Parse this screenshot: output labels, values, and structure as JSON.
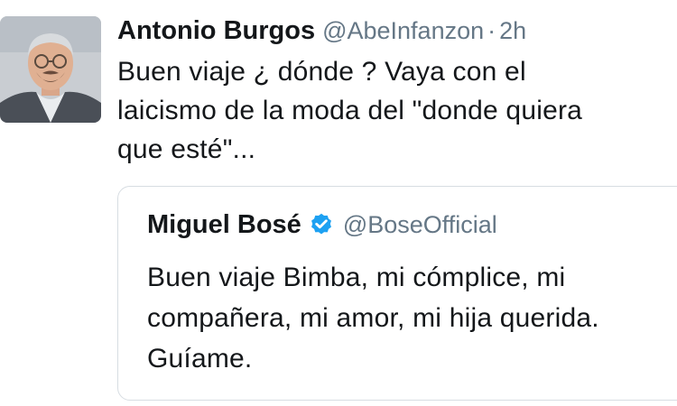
{
  "tweet": {
    "author_name": "Antonio Burgos",
    "author_handle": "@AbeInfanzon",
    "separator": "·",
    "time": "2h",
    "text_lines": [
      "Buen viaje ¿ dónde ? Vaya con el",
      "laicismo de la moda del \"donde quiera",
      "que esté\"..."
    ]
  },
  "quoted_tweet": {
    "author_name": "Miguel Bosé",
    "verified": true,
    "verified_icon": "verified-badge-icon",
    "author_handle": "@BoseOfficial",
    "text_lines": [
      "Buen viaje Bimba, mi cómplice, mi",
      "compañera, mi amor, mi hija querida.",
      "Guíame."
    ]
  },
  "colors": {
    "text": "#14171a",
    "secondary": "#657786",
    "verified": "#1da1f2",
    "border": "#d7dde2"
  }
}
